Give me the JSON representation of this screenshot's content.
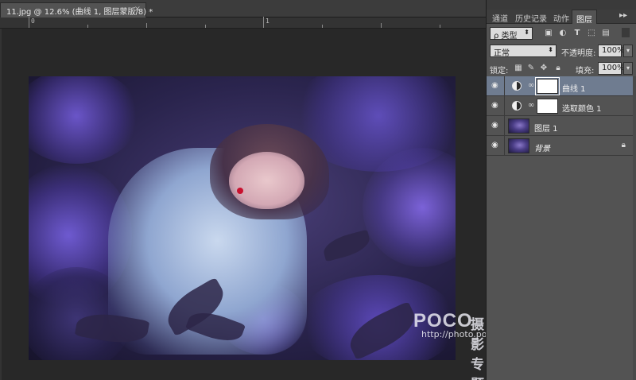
{
  "document": {
    "tab_title": "11.jpg @ 12.6% (曲线 1, 图层蒙版/8) *",
    "tab_close_glyph": "×",
    "ruler_labels": [
      "0",
      "1"
    ],
    "watermark": {
      "brand": "POCO",
      "brand_cn": "摄影专题",
      "url": "http://photo.poco.cn/"
    }
  },
  "panel": {
    "tabs": [
      {
        "label": "通道",
        "active": false
      },
      {
        "label": "历史记录",
        "active": false
      },
      {
        "label": "动作",
        "active": false
      },
      {
        "label": "图层",
        "active": true
      }
    ],
    "menu_glyph": "▸▸",
    "filter": {
      "kind_label": "ρ 类型",
      "filter_icons": [
        "pixel-filter-icon",
        "adjustment-filter-icon",
        "type-filter-icon",
        "shape-filter-icon",
        "smart-object-filter-icon"
      ]
    },
    "blend_mode": "正常",
    "opacity_label": "不透明度:",
    "opacity_value": "100%",
    "lock_label": "锁定:",
    "fill_label": "填充:",
    "fill_value": "100%",
    "layers": [
      {
        "name": "曲线 1",
        "kind": "adjustment",
        "selected": true,
        "visible": true
      },
      {
        "name": "选取颜色 1",
        "kind": "adjustment",
        "selected": false,
        "visible": true
      },
      {
        "name": "图层 1",
        "kind": "pixel",
        "selected": false,
        "visible": true
      },
      {
        "name": "背景",
        "kind": "background",
        "selected": false,
        "visible": true,
        "locked": true
      }
    ]
  },
  "colors": {
    "panel_bg": "#535353",
    "canvas_bg": "#282828",
    "selected_layer": "#6f7c90",
    "photo_purple": "#4a3d86"
  }
}
